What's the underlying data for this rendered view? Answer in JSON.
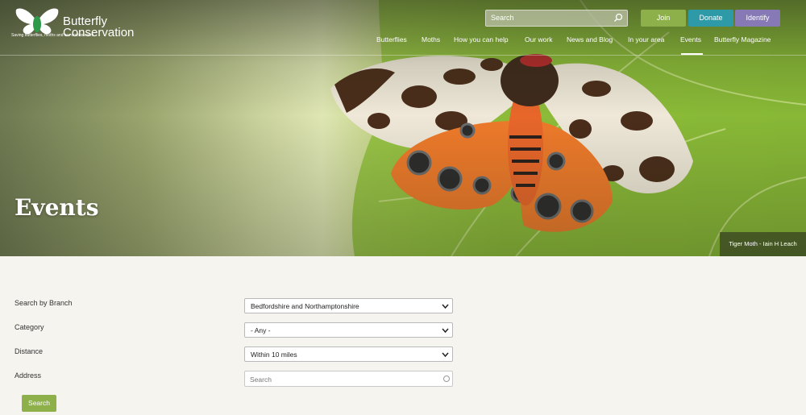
{
  "header": {
    "logo_line1": "Butterfly",
    "logo_line2": "Conservation",
    "logo_tagline": "Saving butterflies, moths and our environment",
    "search_placeholder": "Search",
    "join_label": "Join",
    "donate_label": "Donate",
    "identify_label": "Identify",
    "colors": {
      "join": "#8db04a",
      "donate": "#2e9aa8",
      "identify": "#8679b5"
    }
  },
  "nav": {
    "items": [
      "Butterflies",
      "Moths",
      "How you can help",
      "Our work",
      "News and Blog",
      "In your area",
      "Events",
      "Butterfly Magazine"
    ],
    "active": "Events"
  },
  "hero": {
    "title": "Events",
    "photo_credit": "Tiger Moth - Iain H Leach"
  },
  "form": {
    "branch_label": "Search by Branch",
    "branch_value": "Bedfordshire and Northamptonshire",
    "category_label": "Category",
    "category_value": "- Any -",
    "distance_label": "Distance",
    "distance_value": "Within 10 miles",
    "address_label": "Address",
    "address_placeholder": "Search",
    "submit_label": "Search"
  }
}
